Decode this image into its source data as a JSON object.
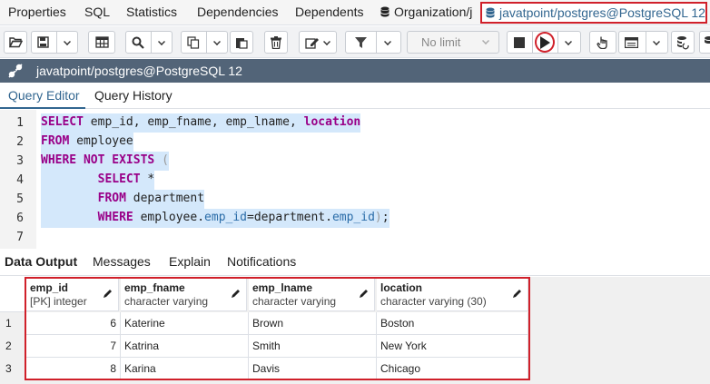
{
  "top_tabs": [
    "Properties",
    "SQL",
    "Statistics",
    "Dependencies",
    "Dependents",
    "Organization/j"
  ],
  "active_tab": "javatpoint/postgres@PostgreSQL 12",
  "toolbar": {
    "limit_label": "No limit"
  },
  "connection": {
    "label": "javatpoint/postgres@PostgreSQL 12"
  },
  "editor_tabs": [
    "Query Editor",
    "Query History"
  ],
  "code_lines": [
    "SELECT emp_id, emp_fname, emp_lname, location",
    "FROM employee",
    "WHERE NOT EXISTS (",
    "        SELECT *",
    "        FROM department",
    "        WHERE employee.emp_id=department.emp_id);"
  ],
  "line_numbers": [
    "1",
    "2",
    "3",
    "4",
    "5",
    "6",
    "7"
  ],
  "output_tabs": [
    "Data Output",
    "Messages",
    "Explain",
    "Notifications"
  ],
  "columns": [
    {
      "name": "emp_id",
      "type": "[PK] integer"
    },
    {
      "name": "emp_fname",
      "type": "character varying"
    },
    {
      "name": "emp_lname",
      "type": "character varying"
    },
    {
      "name": "location",
      "type": "character varying (30)"
    }
  ],
  "rows": [
    {
      "num": "1",
      "cells": [
        "6",
        "Katerine",
        "Brown",
        "Boston"
      ]
    },
    {
      "num": "2",
      "cells": [
        "7",
        "Katrina",
        "Smith",
        "New York"
      ]
    },
    {
      "num": "3",
      "cells": [
        "8",
        "Karina",
        "Davis",
        "Chicago"
      ]
    }
  ],
  "colors": {
    "accent": "#326690",
    "highlight": "#d0202a",
    "conn_bar": "#526478",
    "selection": "#d4e8fb"
  }
}
